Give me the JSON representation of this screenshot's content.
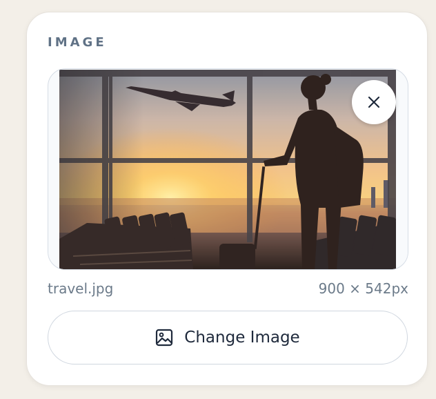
{
  "panel": {
    "section_title": "IMAGE",
    "file_name": "travel.jpg",
    "dimensions": "900 × 542px",
    "change_button_label": "Change Image",
    "remove_icon": "close-icon",
    "change_icon": "image-icon",
    "image_alt": "Silhouette of a traveler with luggage watching an airplane take off through an airport window at sunset"
  },
  "colors": {
    "accent_text": "#1e293b",
    "muted_text": "#6b7a89",
    "section_title": "#607286",
    "page_background": "#f3efe8"
  }
}
